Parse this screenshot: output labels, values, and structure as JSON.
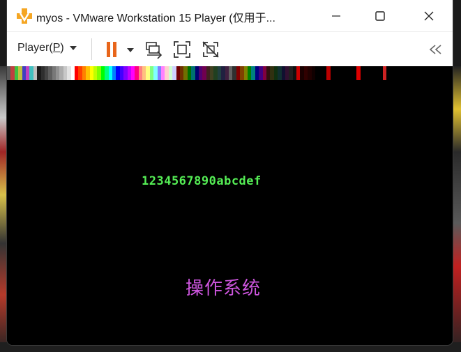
{
  "window": {
    "title": "myos - VMware Workstation 15 Player (仅用于...",
    "icon": "vmware-icon",
    "controls": [
      "minimize-icon",
      "maximize-icon",
      "close-icon"
    ]
  },
  "toolbar": {
    "player_menu_prefix": "Player(",
    "player_menu_key": "P",
    "player_menu_suffix": ")",
    "icons": [
      "pause-icon",
      "send-ctrl-alt-del-icon",
      "full-screen-icon",
      "unity-icon",
      "collapse-toolbar-icon"
    ],
    "pause_color": "#e8651a",
    "collapse_label": "≪"
  },
  "vm_screen": {
    "hex_text": "1234567890abcdef",
    "hex_color": "#55ee55",
    "os_name": "操作系统",
    "os_name_color": "#cc55dd"
  }
}
